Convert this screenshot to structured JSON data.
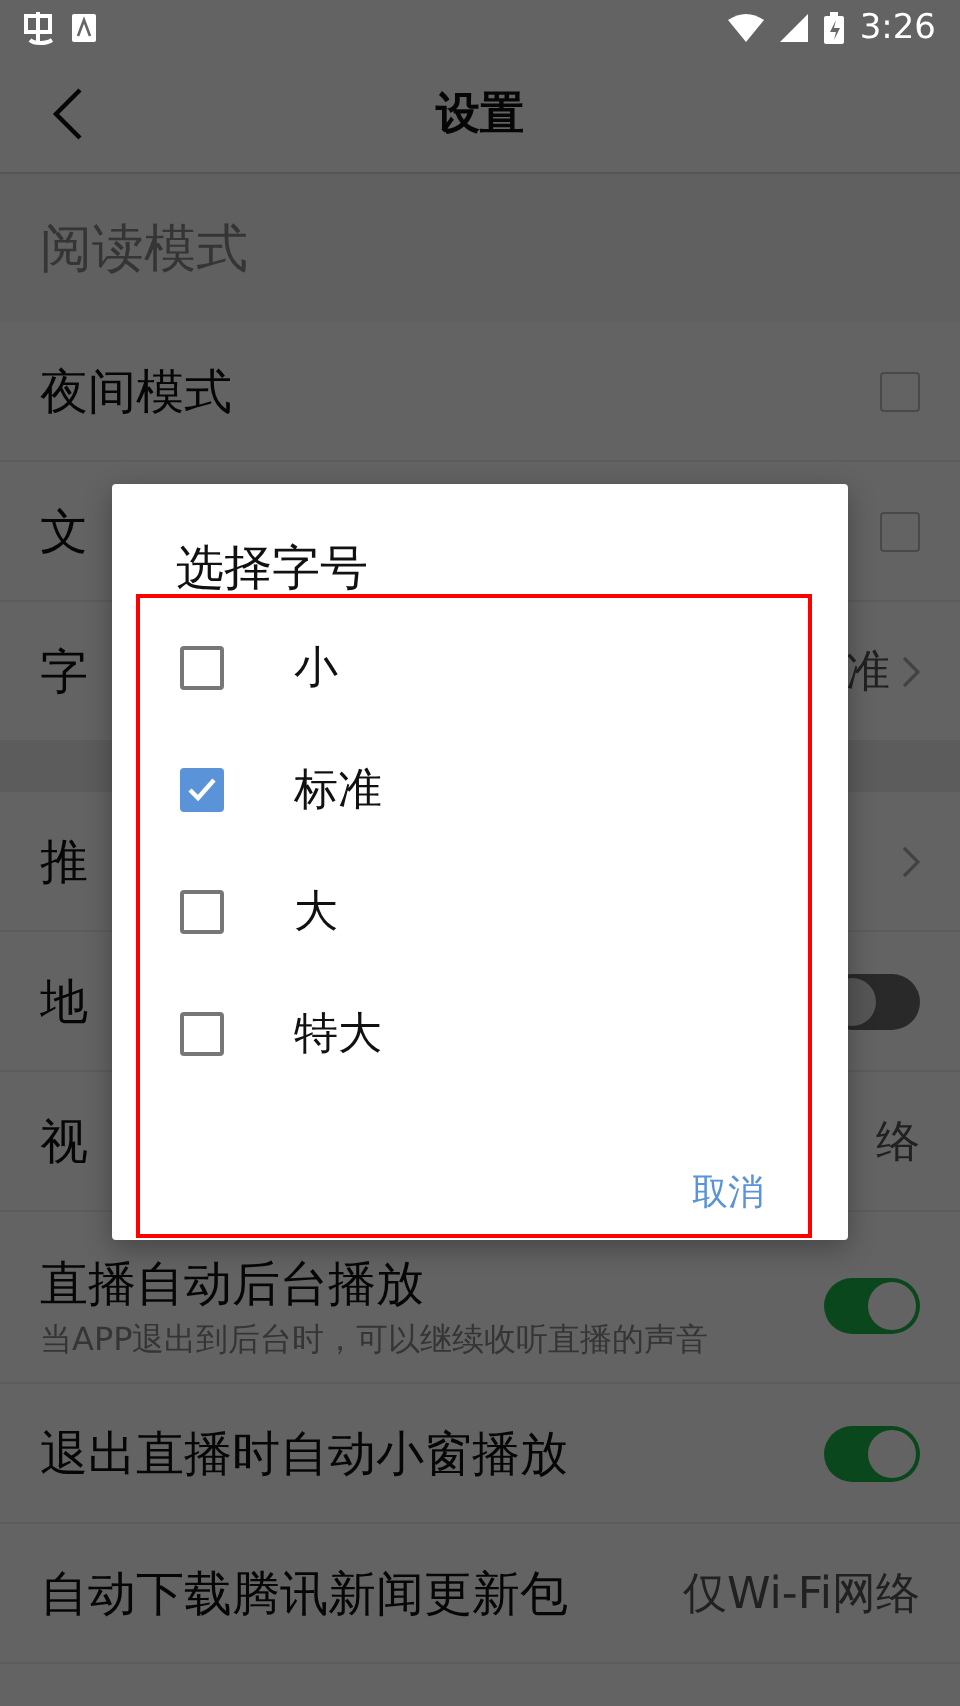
{
  "status_bar": {
    "time": "3:26"
  },
  "header": {
    "title": "设置"
  },
  "settings": [
    {
      "kind": "section",
      "label": "阅读模式"
    },
    {
      "kind": "checkbox",
      "label": "夜间模式",
      "checked": false
    },
    {
      "kind": "checkbox",
      "label": "文",
      "checked": false
    },
    {
      "kind": "value",
      "label": "字",
      "value": "准",
      "chevron": true
    },
    {
      "kind": "spacer"
    },
    {
      "kind": "value",
      "label": "推",
      "chevron": true
    },
    {
      "kind": "toggle",
      "label": "地",
      "on": false
    },
    {
      "kind": "value",
      "label": "视",
      "value": "络",
      "chevron": false
    },
    {
      "kind": "toggle",
      "label": "直播自动后台播放",
      "subtitle": "当APP退出到后台时，可以继续收听直播的声音",
      "on": true
    },
    {
      "kind": "toggle",
      "label": "退出直播时自动小窗播放",
      "on": true
    },
    {
      "kind": "value",
      "label": "自动下载腾讯新闻更新包",
      "value": "仅Wi-Fi网络",
      "chevron": false
    }
  ],
  "dialog": {
    "title": "选择字号",
    "options": [
      {
        "label": "小",
        "selected": false
      },
      {
        "label": "标准",
        "selected": true
      },
      {
        "label": "大",
        "selected": false
      },
      {
        "label": "特大",
        "selected": false
      }
    ],
    "cancel": "取消"
  }
}
